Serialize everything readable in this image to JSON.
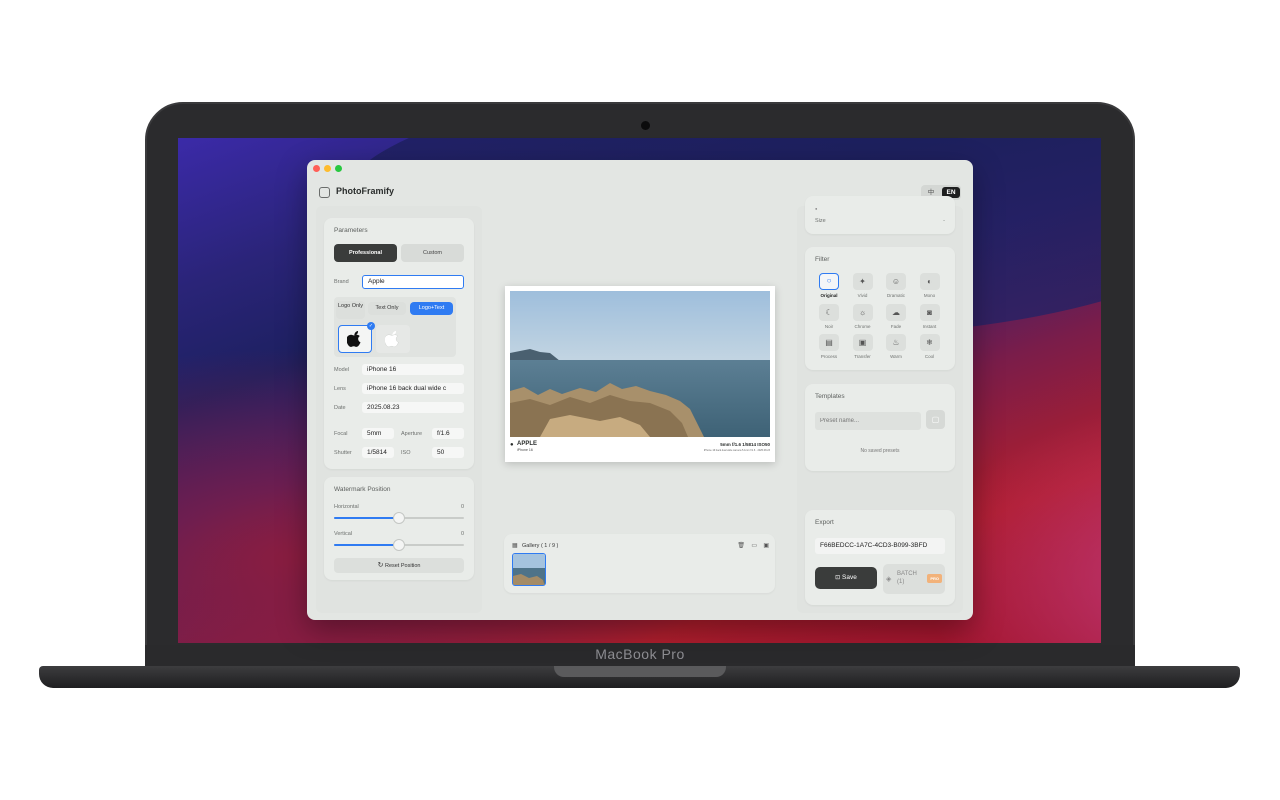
{
  "device": {
    "label": "MacBook Pro"
  },
  "app": {
    "title": "PhotoFramify",
    "lang_zh": "中",
    "lang_en": "EN"
  },
  "parameters": {
    "title": "Parameters",
    "mode_professional": "Professional",
    "mode_custom": "Custom",
    "brand_label": "Brand",
    "brand_value": "Apple",
    "logo_modes": [
      "Logo Only",
      "Text Only",
      "Logo+Text"
    ],
    "logo_selected": "Logo+Text",
    "model_label": "Model",
    "model_value": "iPhone 16",
    "lens_label": "Lens",
    "lens_value": "iPhone 16 back dual wide c",
    "date_label": "Date",
    "date_value": "2025.08.23",
    "focal_label": "Focal",
    "focal_value": "5mm",
    "aperture_label": "Aperture",
    "aperture_value": "f/1.6",
    "shutter_label": "Shutter",
    "shutter_value": "1/5814",
    "iso_label": "ISO",
    "iso_value": "50"
  },
  "watermark": {
    "title": "Watermark Position",
    "horizontal_label": "Horizontal",
    "horizontal_value": "0",
    "horizontal_level": 0.5,
    "vertical_label": "Vertical",
    "vertical_value": "0",
    "vertical_level": 0.5,
    "reset_label": "Reset Position"
  },
  "preview": {
    "brand": "APPLE",
    "model": "iPhone 16",
    "exif": "5mm  f/1.6  1/5814  ISO50",
    "subline": "iPhone 16 back dual wide camera 5.1mm f/1.6 · 2025.08.23"
  },
  "gallery": {
    "label": "Gallery ( 1 / 9 )"
  },
  "info": {
    "size_label": "Size",
    "size_value": "-"
  },
  "filter": {
    "title": "Filter",
    "selected": "Original",
    "items": [
      {
        "name": "Original",
        "glyph": "○"
      },
      {
        "name": "Vivid",
        "glyph": "✦"
      },
      {
        "name": "Dramatic",
        "glyph": "☺"
      },
      {
        "name": "Mono",
        "glyph": "◐"
      },
      {
        "name": "Noir",
        "glyph": "☾"
      },
      {
        "name": "Chrome",
        "glyph": "☼"
      },
      {
        "name": "Fade",
        "glyph": "☁"
      },
      {
        "name": "Instant",
        "glyph": "◙"
      },
      {
        "name": "Process",
        "glyph": "▤"
      },
      {
        "name": "Transfer",
        "glyph": "▣"
      },
      {
        "name": "Warm",
        "glyph": "♨"
      },
      {
        "name": "Cool",
        "glyph": "❄"
      }
    ]
  },
  "templates": {
    "title": "Templates",
    "preset_placeholder": "Preset name...",
    "empty_text": "No saved presets"
  },
  "export": {
    "title": "Export",
    "file_id": "F66BEDCC-1A7C-4CD3-B099-3BFD",
    "save_label": "Save",
    "batch_label": "BATCH",
    "batch_count": "(1)",
    "pro_badge": "PRO"
  },
  "colors": {
    "accent": "#2f7bf2",
    "dark_button": "#3a3c3b",
    "window_bg": "#e3e6e3",
    "pro_badge": "#f2b27a"
  }
}
